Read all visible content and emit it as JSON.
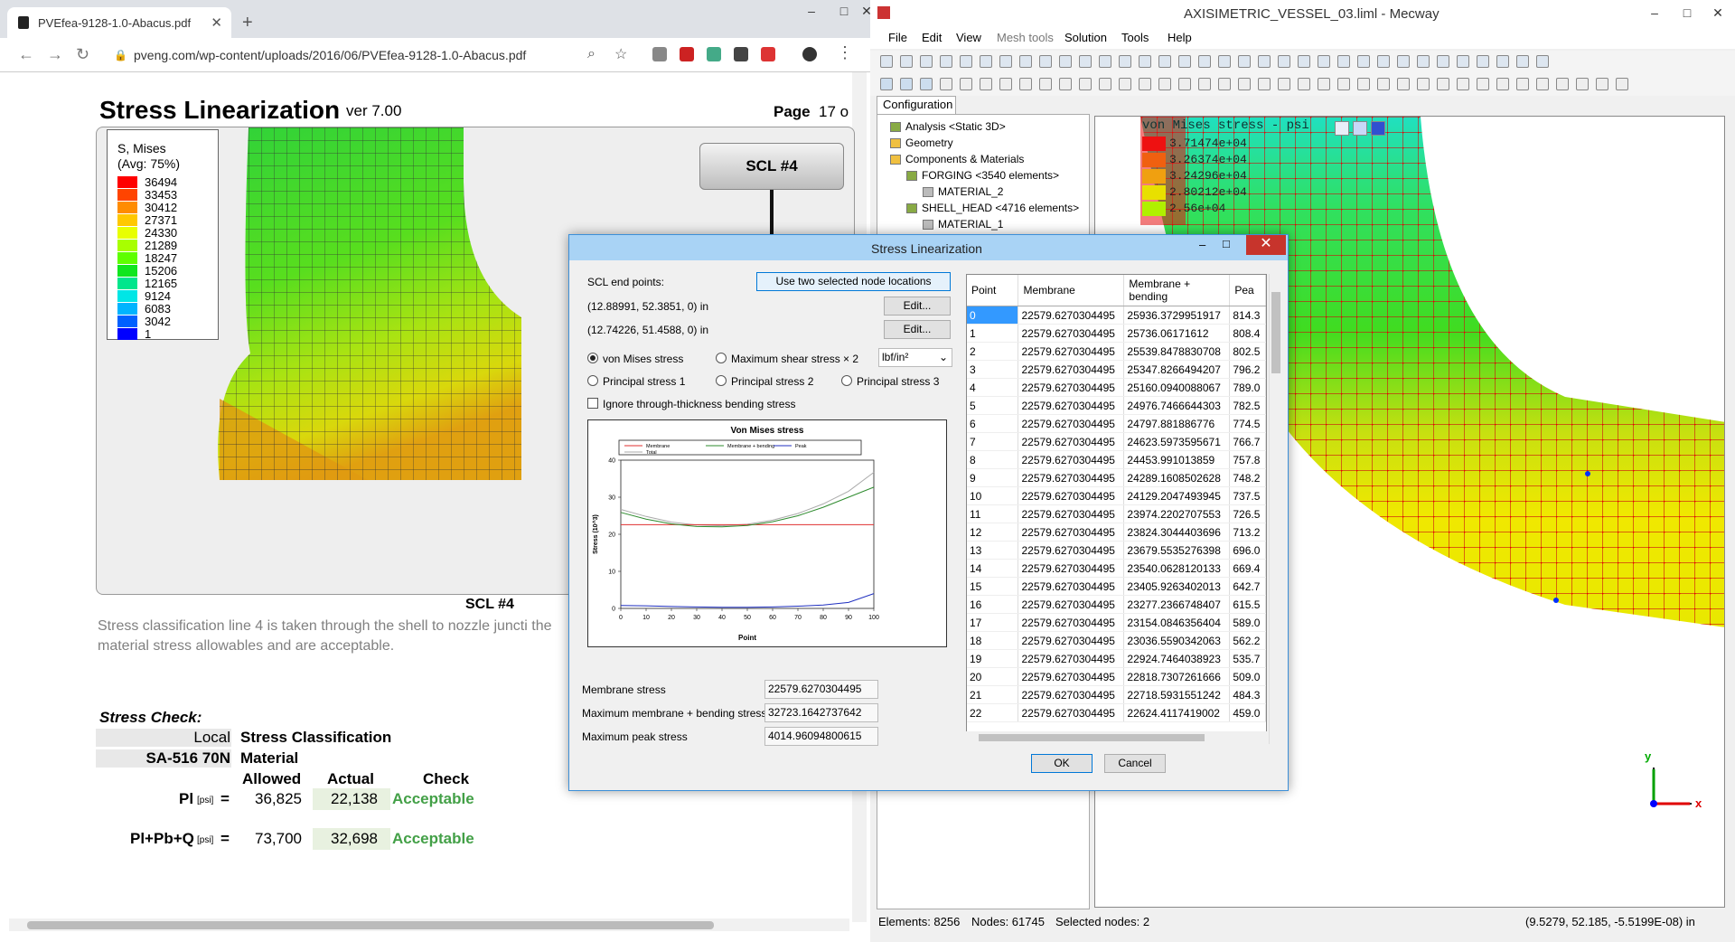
{
  "browser": {
    "tab_title": "PVEfea-9128-1.0-Abacus.pdf",
    "tab_close": "✕",
    "new_tab": "+",
    "url": "pveng.com/wp-content/uploads/2016/06/PVEfea-9128-1.0-Abacus.pdf",
    "win_min": "–",
    "win_max": "□",
    "win_close": "✕"
  },
  "pdf": {
    "title": "Stress Linearization",
    "version": "ver 7.00",
    "page_label": "Page",
    "page_number": "17 o",
    "legend_title_1": "S, Mises",
    "legend_title_2": "(Avg: 75%)",
    "legend_values": [
      "36494",
      "33453",
      "30412",
      "27371",
      "24330",
      "21289",
      "18247",
      "15206",
      "12165",
      "9124",
      "6083",
      "3042",
      "1"
    ],
    "legend_colors": [
      "#ff0000",
      "#ff4400",
      "#ff8c00",
      "#ffc800",
      "#e8ff00",
      "#a8ff00",
      "#5eff00",
      "#10e61e",
      "#00e68c",
      "#00e6e6",
      "#00b4ff",
      "#0060ff",
      "#0000ff"
    ],
    "scl_label": "SCL #4",
    "plot_caption": "SCL #4",
    "paragraph": "Stress classification line 4 is taken through the shell to nozzle juncti the material stress allowables and are acceptable.",
    "check_title": "Stress Check:",
    "row1_left": "Local",
    "row1_right": "Stress Classification",
    "row2_left": "SA-516 70N",
    "row2_right": "Material",
    "col_allowed": "Allowed",
    "col_actual": "Actual",
    "col_check": "Check",
    "pl_label": "Pl",
    "pl_unit": "[psi]",
    "pl_eq": "=",
    "pl_allowed": "36,825",
    "pl_actual": "22,138",
    "pl_check": "Acceptable",
    "plpbq_label": "Pl+Pb+Q",
    "plpbq_unit": "[psi]",
    "plpbq_eq": "=",
    "plpbq_allowed": "73,700",
    "plpbq_actual": "32,698",
    "plpbq_check": "Acceptable"
  },
  "mecway": {
    "title": "AXISIMETRIC_VESSEL_03.liml - Mecway",
    "menu": [
      "File",
      "Edit",
      "View",
      "Mesh tools",
      "Solution",
      "Tools",
      "Help"
    ],
    "config_tab": "Configuration",
    "tree": [
      {
        "label": "Analysis <Static 3D>",
        "indent": 0
      },
      {
        "label": "Geometry",
        "indent": 0
      },
      {
        "label": "Components & Materials",
        "indent": 0
      },
      {
        "label": "FORGING <3540 elements>",
        "indent": 1
      },
      {
        "label": "MATERIAL_2",
        "indent": 2
      },
      {
        "label": "SHELL_HEAD <4716 elements>",
        "indent": 1
      },
      {
        "label": "MATERIAL_1",
        "indent": 2
      }
    ],
    "view_overlay": "von Mises stress - psi",
    "view_legend": [
      "3.71474e+04",
      "3.26374e+04",
      "3.24296e+04",
      "2.80212e+04",
      "2.56e+04"
    ],
    "status_elements": "Elements: 8256",
    "status_nodes": "Nodes: 61745",
    "status_selected": "Selected nodes: 2",
    "status_coords": "(9.5279, 52.185, -5.5199E-08) in"
  },
  "dialog": {
    "title": "Stress Linearization",
    "close": "✕",
    "scl_end_points": "SCL end points:",
    "use_nodes_button": "Use two selected node locations",
    "point1": "(12.88991, 52.3851, 0) in",
    "point2": "(12.74226, 51.4588, 0) in",
    "edit_button": "Edit...",
    "radio_von_mises": "von Mises stress",
    "radio_max_shear": "Maximum shear stress × 2",
    "radio_p1": "Principal stress 1",
    "radio_p2": "Principal stress 2",
    "radio_p3": "Principal stress 3",
    "unit_select": "lbf/in²",
    "ignore_bending": "Ignore through-thickness bending stress",
    "membrane_label": "Membrane stress",
    "membrane_value": "22579.6270304495",
    "mb_label": "Maximum membrane + bending stress",
    "mb_value": "32723.1642737642",
    "peak_label": "Maximum peak stress",
    "peak_value": "4014.96094800615",
    "ok": "OK",
    "cancel": "Cancel",
    "grid_headers": [
      "Point",
      "Membrane",
      "Membrane + bending",
      "Pea"
    ],
    "grid_rows": [
      [
        "0",
        "22579.6270304495",
        "25936.3729951917",
        "814.3"
      ],
      [
        "1",
        "22579.6270304495",
        "25736.06171612",
        "808.4"
      ],
      [
        "2",
        "22579.6270304495",
        "25539.8478830708",
        "802.5"
      ],
      [
        "3",
        "22579.6270304495",
        "25347.8266494207",
        "796.2"
      ],
      [
        "4",
        "22579.6270304495",
        "25160.0940088067",
        "789.0"
      ],
      [
        "5",
        "22579.6270304495",
        "24976.7466644303",
        "782.5"
      ],
      [
        "6",
        "22579.6270304495",
        "24797.881886776",
        "774.5"
      ],
      [
        "7",
        "22579.6270304495",
        "24623.5973595671",
        "766.7"
      ],
      [
        "8",
        "22579.6270304495",
        "24453.991013859",
        "757.8"
      ],
      [
        "9",
        "22579.6270304495",
        "24289.1608502628",
        "748.2"
      ],
      [
        "10",
        "22579.6270304495",
        "24129.2047493945",
        "737.5"
      ],
      [
        "11",
        "22579.6270304495",
        "23974.2202707553",
        "726.5"
      ],
      [
        "12",
        "22579.6270304495",
        "23824.3044403696",
        "713.2"
      ],
      [
        "13",
        "22579.6270304495",
        "23679.5535276398",
        "696.0"
      ],
      [
        "14",
        "22579.6270304495",
        "23540.0628120133",
        "669.4"
      ],
      [
        "15",
        "22579.6270304495",
        "23405.9263402013",
        "642.7"
      ],
      [
        "16",
        "22579.6270304495",
        "23277.2366748407",
        "615.5"
      ],
      [
        "17",
        "22579.6270304495",
        "23154.0846356404",
        "589.0"
      ],
      [
        "18",
        "22579.6270304495",
        "23036.5590342063",
        "562.2"
      ],
      [
        "19",
        "22579.6270304495",
        "22924.7464038923",
        "535.7"
      ],
      [
        "20",
        "22579.6270304495",
        "22818.7307261666",
        "509.0"
      ],
      [
        "21",
        "22579.6270304495",
        "22718.5931551242",
        "484.3"
      ],
      [
        "22",
        "22579.6270304495",
        "22624.4117419002",
        "459.0"
      ]
    ]
  },
  "chart_data": {
    "type": "line",
    "title": "Von Mises stress",
    "xlabel": "Point",
    "ylabel": "Stress (10^3)",
    "xlim": [
      0,
      100
    ],
    "ylim": [
      0,
      40
    ],
    "xticks": [
      0,
      10,
      20,
      30,
      40,
      50,
      60,
      70,
      80,
      90,
      100
    ],
    "yticks": [
      0,
      10,
      20,
      30,
      40
    ],
    "legend_placement": "top",
    "x": [
      0,
      10,
      20,
      30,
      40,
      50,
      60,
      70,
      80,
      90,
      100
    ],
    "series": [
      {
        "name": "Membrane",
        "color": "#e03030",
        "values": [
          22.58,
          22.58,
          22.58,
          22.58,
          22.58,
          22.58,
          22.58,
          22.58,
          22.58,
          22.58,
          22.58
        ]
      },
      {
        "name": "Membrane + bending",
        "color": "#2e8b2e",
        "values": [
          25.9,
          24.1,
          22.8,
          22.1,
          22.0,
          22.4,
          23.4,
          25.0,
          27.3,
          30.0,
          32.7
        ]
      },
      {
        "name": "Peak",
        "color": "#2030c0",
        "values": [
          0.8,
          0.7,
          0.5,
          0.4,
          0.3,
          0.3,
          0.4,
          0.6,
          0.9,
          1.6,
          4.0
        ]
      },
      {
        "name": "Total",
        "color": "#aaaaaa",
        "values": [
          26.7,
          24.8,
          23.3,
          22.5,
          22.3,
          22.7,
          23.8,
          25.6,
          28.2,
          31.6,
          36.7
        ]
      }
    ]
  }
}
